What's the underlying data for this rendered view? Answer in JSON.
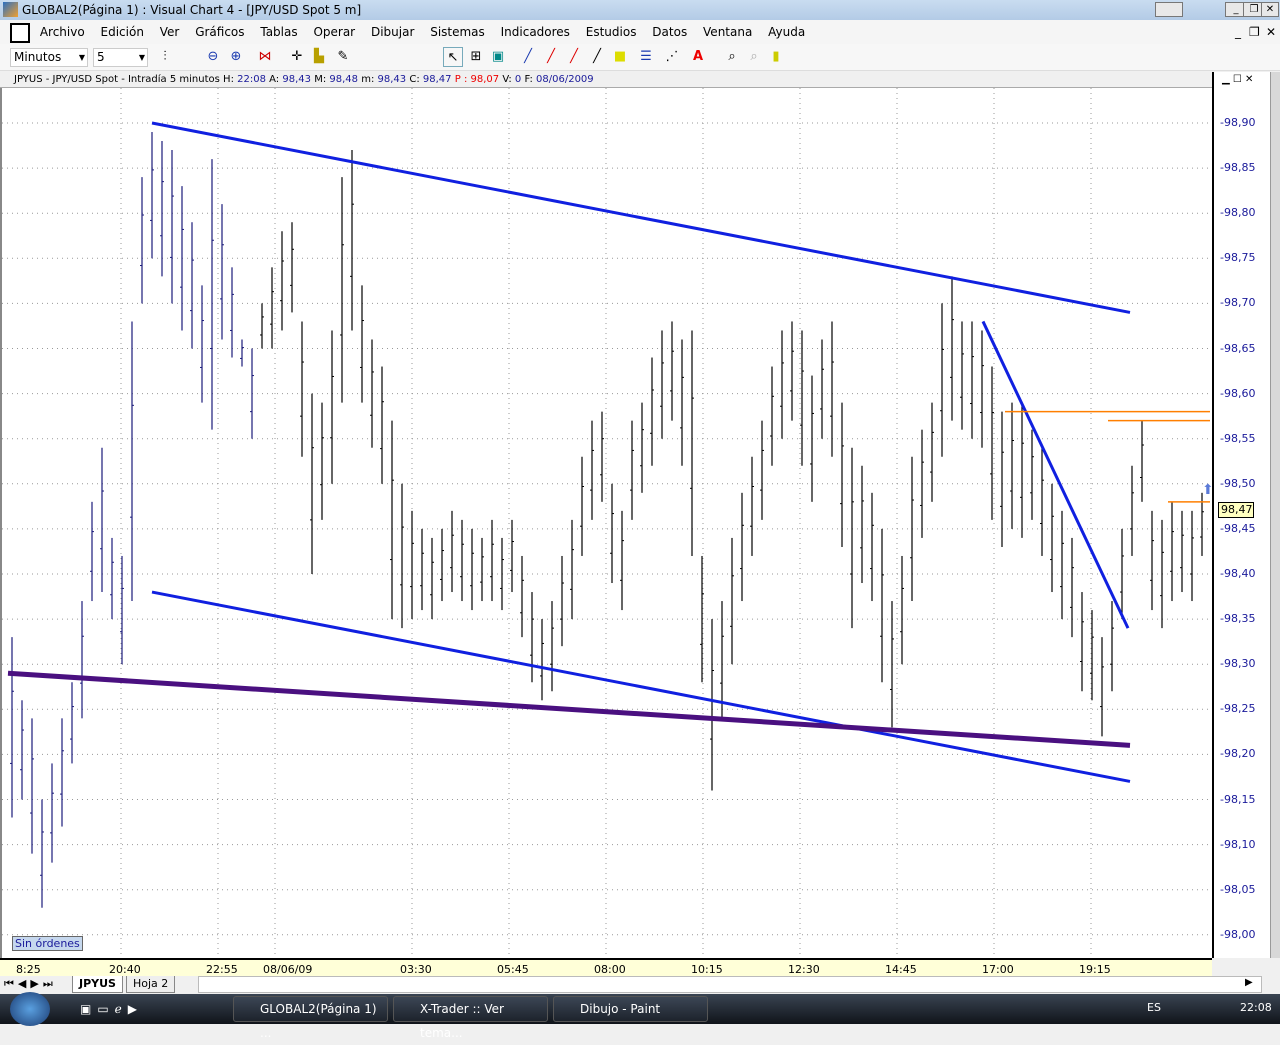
{
  "window": {
    "title": "GLOBAL2(Página 1) : Visual Chart 4 - [JPY/USD Spot 5 m]"
  },
  "menu": [
    "Archivo",
    "Edición",
    "Ver",
    "Gráficos",
    "Tablas",
    "Operar",
    "Dibujar",
    "Sistemas",
    "Indicadores",
    "Estudios",
    "Datos",
    "Ventana",
    "Ayuda"
  ],
  "toolbar": {
    "period_unit": "Minutos",
    "period_value": "5"
  },
  "info": {
    "symbol": "JPYUS - JPY/USD Spot - Intradía 5 minutos",
    "h_label": "H:",
    "h": "22:08",
    "a_label": "A:",
    "a": "98,43",
    "m_label": "M:",
    "m": "98,48",
    "mn_label": "m:",
    "mn": "98,43",
    "c_label": "C:",
    "c": "98,47",
    "p": "P : 98,07",
    "v_label": "V:",
    "v": "0",
    "f_label": "F:",
    "f": "08/06/2009"
  },
  "orders_label": "Sin órdenes",
  "current_price": "98,47",
  "sheet_tabs": [
    "JPYUS",
    "Hoja 2"
  ],
  "taskbar": {
    "items": [
      "GLOBAL2(Página 1) ...",
      "X-Trader :: Ver tema...",
      "Dibujo - Paint"
    ],
    "lang": "ES",
    "clock": "22:08"
  },
  "chart_data": {
    "type": "ohlc-bar",
    "ylim": [
      97.98,
      98.92
    ],
    "yticks": [
      "98,90",
      "98,85",
      "98,80",
      "98,75",
      "98,70",
      "98,65",
      "98,60",
      "98,55",
      "98,50",
      "98,45",
      "98,40",
      "98,35",
      "98,30",
      "98,25",
      "98,20",
      "98,15",
      "98,10",
      "98,05",
      "98,00"
    ],
    "xticks": [
      "8:25",
      "20:40",
      "22:55",
      "08/06/09",
      "03:30",
      "05:45",
      "08:00",
      "10:15",
      "12:30",
      "14:45",
      "17:00",
      "19:15"
    ],
    "bars_high_low": [
      [
        98.33,
        98.13
      ],
      [
        98.26,
        98.15
      ],
      [
        98.24,
        98.09
      ],
      [
        98.15,
        98.03
      ],
      [
        98.19,
        98.08
      ],
      [
        98.24,
        98.12
      ],
      [
        98.28,
        98.19
      ],
      [
        98.37,
        98.24
      ],
      [
        98.48,
        98.37
      ],
      [
        98.54,
        98.38
      ],
      [
        98.44,
        98.35
      ],
      [
        98.42,
        98.3
      ],
      [
        98.68,
        98.37
      ],
      [
        98.84,
        98.7
      ],
      [
        98.89,
        98.75
      ],
      [
        98.88,
        98.73
      ],
      [
        98.87,
        98.7
      ],
      [
        98.83,
        98.67
      ],
      [
        98.79,
        98.65
      ],
      [
        98.72,
        98.59
      ],
      [
        98.86,
        98.56
      ],
      [
        98.81,
        98.66
      ],
      [
        98.74,
        98.64
      ],
      [
        98.66,
        98.63
      ],
      [
        98.65,
        98.55
      ],
      [
        98.7,
        98.65
      ],
      [
        98.74,
        98.65
      ],
      [
        98.78,
        98.67
      ],
      [
        98.79,
        98.69
      ],
      [
        98.68,
        98.53
      ],
      [
        98.6,
        98.4
      ],
      [
        98.59,
        98.46
      ],
      [
        98.67,
        98.5
      ],
      [
        98.84,
        98.59
      ],
      [
        98.87,
        98.67
      ],
      [
        98.72,
        98.59
      ],
      [
        98.66,
        98.54
      ],
      [
        98.63,
        98.5
      ],
      [
        98.57,
        98.35
      ],
      [
        98.5,
        98.34
      ],
      [
        98.47,
        98.35
      ],
      [
        98.45,
        98.36
      ],
      [
        98.44,
        98.35
      ],
      [
        98.45,
        98.37
      ],
      [
        98.47,
        98.38
      ],
      [
        98.46,
        98.37
      ],
      [
        98.45,
        98.36
      ],
      [
        98.44,
        98.37
      ],
      [
        98.46,
        98.37
      ],
      [
        98.44,
        98.36
      ],
      [
        98.46,
        98.38
      ],
      [
        98.42,
        98.33
      ],
      [
        98.38,
        98.28
      ],
      [
        98.35,
        98.26
      ],
      [
        98.37,
        98.27
      ],
      [
        98.42,
        98.32
      ],
      [
        98.46,
        98.35
      ],
      [
        98.53,
        98.42
      ],
      [
        98.57,
        98.46
      ],
      [
        98.58,
        98.48
      ],
      [
        98.5,
        98.39
      ],
      [
        98.47,
        98.36
      ],
      [
        98.57,
        98.46
      ],
      [
        98.59,
        98.49
      ],
      [
        98.64,
        98.52
      ],
      [
        98.67,
        98.55
      ],
      [
        98.68,
        98.57
      ],
      [
        98.66,
        98.52
      ],
      [
        98.67,
        98.42
      ],
      [
        98.42,
        98.28
      ],
      [
        98.35,
        98.16
      ],
      [
        98.37,
        98.24
      ],
      [
        98.44,
        98.3
      ],
      [
        98.49,
        98.37
      ],
      [
        98.53,
        98.42
      ],
      [
        98.57,
        98.46
      ],
      [
        98.63,
        98.52
      ],
      [
        98.67,
        98.55
      ],
      [
        98.68,
        98.57
      ],
      [
        98.67,
        98.52
      ],
      [
        98.62,
        98.48
      ],
      [
        98.66,
        98.55
      ],
      [
        98.68,
        98.53
      ],
      [
        98.59,
        98.43
      ],
      [
        98.54,
        98.34
      ],
      [
        98.52,
        98.39
      ],
      [
        98.49,
        98.37
      ],
      [
        98.45,
        98.28
      ],
      [
        98.37,
        98.23
      ],
      [
        98.42,
        98.3
      ],
      [
        98.53,
        98.37
      ],
      [
        98.56,
        98.44
      ],
      [
        98.59,
        98.48
      ],
      [
        98.7,
        98.53
      ],
      [
        98.73,
        98.57
      ],
      [
        98.68,
        98.56
      ],
      [
        98.68,
        98.55
      ],
      [
        98.67,
        98.54
      ],
      [
        98.63,
        98.46
      ],
      [
        98.58,
        98.43
      ],
      [
        98.59,
        98.45
      ],
      [
        98.59,
        98.44
      ],
      [
        98.56,
        98.46
      ],
      [
        98.54,
        98.42
      ],
      [
        98.5,
        98.38
      ],
      [
        98.47,
        98.35
      ],
      [
        98.44,
        98.33
      ],
      [
        98.38,
        98.27
      ],
      [
        98.36,
        98.26
      ],
      [
        98.33,
        98.22
      ],
      [
        98.37,
        98.27
      ],
      [
        98.45,
        98.35
      ],
      [
        98.52,
        98.42
      ],
      [
        98.57,
        98.48
      ],
      [
        98.47,
        98.36
      ],
      [
        98.46,
        98.34
      ],
      [
        98.48,
        98.37
      ],
      [
        98.47,
        98.38
      ],
      [
        98.47,
        98.37
      ],
      [
        98.49,
        98.42
      ]
    ],
    "trendlines": [
      {
        "from": [
          14.2,
          98.9
        ],
        "to": [
          112,
          98.69
        ],
        "color": "#1020e0"
      },
      {
        "from": [
          14.2,
          98.38
        ],
        "to": [
          112,
          98.17
        ],
        "color": "#1020e0"
      },
      {
        "from": [
          -0.2,
          98.29
        ],
        "to": [
          112,
          98.21
        ],
        "color": "#4a1080"
      },
      {
        "from": [
          97.3,
          98.68
        ],
        "to": [
          111.8,
          98.34
        ],
        "color": "#1020e0"
      },
      {
        "from": [
          99.5,
          98.58
        ],
        "to": [
          120,
          98.58
        ],
        "color": "#ff7f00"
      },
      {
        "from": [
          109.8,
          98.57
        ],
        "to": [
          120,
          98.57
        ],
        "color": "#ff7f00"
      },
      {
        "from": [
          115.8,
          98.48
        ],
        "to": [
          120,
          98.48
        ],
        "color": "#ff7f00"
      }
    ]
  }
}
